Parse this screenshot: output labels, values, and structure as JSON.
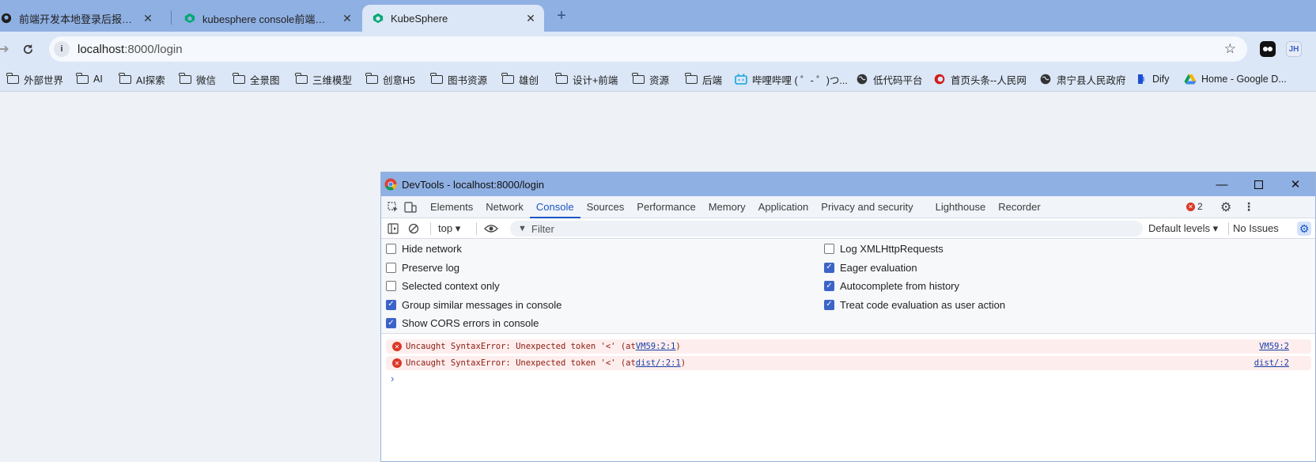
{
  "tabs": [
    {
      "title": "前端开发本地登录后报服务器错误",
      "close": "✕",
      "active": false
    },
    {
      "title": "kubesphere console前端源码本地",
      "close": "✕",
      "active": false
    },
    {
      "title": "KubeSphere",
      "close": "✕",
      "active": true
    }
  ],
  "new_tab": "+",
  "address": {
    "host": "localhost",
    "path": ":8000/login"
  },
  "profile_badge": "JH",
  "bookmarks": [
    {
      "label": "外部世界",
      "icon": "folder-icon"
    },
    {
      "label": "AI",
      "icon": "folder-icon"
    },
    {
      "label": "AI探索",
      "icon": "folder-icon"
    },
    {
      "label": "微信",
      "icon": "folder-icon"
    },
    {
      "label": "全景图",
      "icon": "folder-icon"
    },
    {
      "label": "三维模型",
      "icon": "folder-icon"
    },
    {
      "label": "创意H5",
      "icon": "folder-icon"
    },
    {
      "label": "图书资源",
      "icon": "folder-icon"
    },
    {
      "label": "雄创",
      "icon": "folder-icon"
    },
    {
      "label": "设计+前端",
      "icon": "folder-icon"
    },
    {
      "label": "资源",
      "icon": "folder-icon"
    },
    {
      "label": "后端",
      "icon": "folder-icon"
    },
    {
      "label": "哔哩哔哩 ( ゜- ゜)つ...",
      "icon": "bilibili-icon"
    },
    {
      "label": "低代码平台",
      "icon": "globe-icon"
    },
    {
      "label": "首页头条--人民网",
      "icon": "people-daily-icon"
    },
    {
      "label": "肃宁县人民政府",
      "icon": "globe-icon"
    },
    {
      "label": "Dify",
      "icon": "dify-icon"
    },
    {
      "label": "Home - Google D...",
      "icon": "google-drive-icon"
    }
  ],
  "devtools": {
    "title": "DevTools - localhost:8000/login",
    "tabs": [
      "Elements",
      "Network",
      "Console",
      "Sources",
      "Performance",
      "Memory",
      "Application",
      "Privacy and security",
      "Lighthouse",
      "Recorder"
    ],
    "active_tab": "Console",
    "error_count": "2",
    "context": "top",
    "filter_placeholder": "Filter",
    "levels": "Default levels",
    "issues": "No Issues",
    "settings_left": [
      {
        "label": "Hide network",
        "checked": false
      },
      {
        "label": "Preserve log",
        "checked": false
      },
      {
        "label": "Selected context only",
        "checked": false
      },
      {
        "label": "Group similar messages in console",
        "checked": true
      },
      {
        "label": "Show CORS errors in console",
        "checked": true
      }
    ],
    "settings_right": [
      {
        "label": "Log XMLHttpRequests",
        "checked": false
      },
      {
        "label": "Eager evaluation",
        "checked": true
      },
      {
        "label": "Autocomplete from history",
        "checked": true
      },
      {
        "label": "Treat code evaluation as user action",
        "checked": true
      }
    ],
    "messages": [
      {
        "text": "Uncaught SyntaxError: Unexpected token '<' (at ",
        "link": "VM59:2:1",
        "tail": ")",
        "source": "VM59:2"
      },
      {
        "text": "Uncaught SyntaxError: Unexpected token '<' (at ",
        "link": "dist/:2:1",
        "tail": ")",
        "source": "dist/:2"
      }
    ],
    "prompt": "›"
  },
  "colors": {
    "tabstrip": "#8fb0e3",
    "toolbar": "#dbe6f6",
    "page": "#eef2f6",
    "accent": "#1a56c4",
    "error": "#dc3626"
  }
}
